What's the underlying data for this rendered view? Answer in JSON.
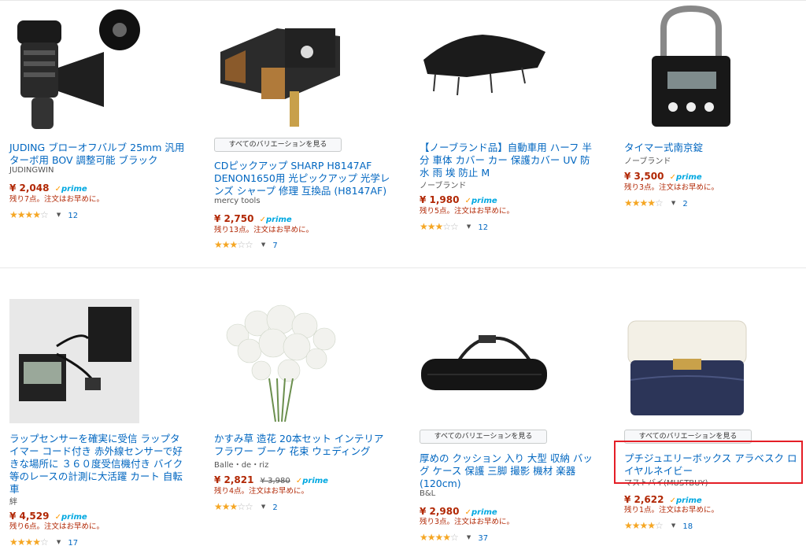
{
  "variation_label": "すべてのバリエーションを見る",
  "products": [
    {
      "title": "JUDING ブローオフバルブ 25mm 汎用ターボ用 BOV 調整可能 ブラック",
      "brand": "JUDINGWIN",
      "price": "¥ 2,048",
      "old_price": "",
      "prime": "prime",
      "stock": "残り7点。注文はお早めに。",
      "rating": 3.5,
      "stars": "★★★★☆",
      "reviews": "12",
      "image_icon": "blowoff-valve-image"
    },
    {
      "title": "CDピックアップ SHARP H8147AF DENON1650用 光ピックアップ 光学レンズ シャープ 修理 互換品 (H8147AF)",
      "brand": "mercy tools",
      "price": "¥ 2,750",
      "old_price": "",
      "prime": "prime",
      "stock": "残り13点。注文はお早めに。",
      "rating": 3,
      "stars": "★★★☆☆",
      "reviews": "7",
      "image_icon": "cd-pickup-image"
    },
    {
      "title": "【ノーブランド品】自動車用 ハーフ 半分 車体 カバー カー 保護カバー UV 防水 雨 埃 防止 M",
      "brand": "ノーブランド",
      "price": "¥ 1,980",
      "old_price": "",
      "prime": "prime",
      "stock": "残り5点。注文はお早めに。",
      "rating": 3,
      "stars": "★★★☆☆",
      "reviews": "12",
      "image_icon": "car-cover-image"
    },
    {
      "title": "タイマー式南京錠",
      "brand": "ノーブランド",
      "price": "¥ 3,500",
      "old_price": "",
      "prime": "prime",
      "stock": "残り3点。注文はお早めに。",
      "rating": 4,
      "stars": "★★★★☆",
      "reviews": "2",
      "image_icon": "timer-padlock-image"
    },
    {
      "title": "ラップセンサーを確実に受信 ラップタイマー コード付き 赤外線センサーで好きな場所に ３６０度受信機付き バイク等のレースの計測に大活躍 カート 自転車",
      "brand": "絆",
      "price": "¥ 4,529",
      "old_price": "",
      "prime": "prime",
      "stock": "残り6点。注文はお早めに。",
      "rating": 4,
      "stars": "★★★★☆",
      "reviews": "17",
      "image_icon": "lap-timer-image"
    },
    {
      "title": "かすみ草 造花 20本セット インテリアフラワー ブーケ 花束 ウェディング",
      "brand": "Balle・de・riz",
      "price": "¥ 2,821",
      "old_price": "¥ 3,980",
      "prime": "prime",
      "stock": "残り4点。注文はお早めに。",
      "rating": 2.5,
      "stars": "★★★☆☆",
      "reviews": "2",
      "image_icon": "babys-breath-flowers-image"
    },
    {
      "title": "厚めの クッション 入り 大型 収納 バッグ ケース 保護 三脚 撮影 機材 楽器 (120cm)",
      "brand": "B&L",
      "price": "¥ 2,980",
      "old_price": "",
      "prime": "prime",
      "stock": "残り3点。注文はお早めに。",
      "rating": 4,
      "stars": "★★★★☆",
      "reviews": "37",
      "image_icon": "tripod-bag-image"
    },
    {
      "title": "プチジュエリーボックス アラベスク ロイヤルネイビー",
      "brand": "マストバイ(MUSTBUY)",
      "price": "¥ 2,622",
      "old_price": "",
      "prime": "prime",
      "stock": "残り1点。注文はお早めに。",
      "rating": 3.5,
      "stars": "★★★★☆",
      "reviews": "18",
      "image_icon": "jewelry-box-image"
    }
  ],
  "colors": {
    "link": "#0066c0",
    "price": "#b12704",
    "star": "#f5a623",
    "prime": "#00a8e1",
    "highlight": "#e41e26"
  }
}
